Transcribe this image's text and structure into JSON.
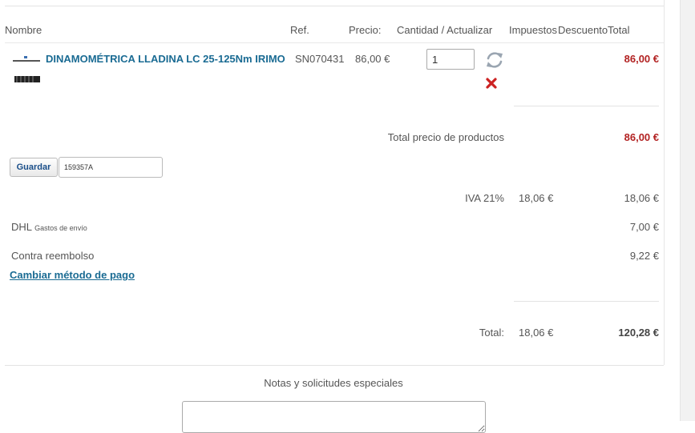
{
  "table_headers": {
    "name": "Nombre",
    "ref": "Ref.",
    "price": "Precio:",
    "quantity": "Cantidad / Actualizar",
    "taxes": "Impuestos",
    "discount": "Descuento",
    "total": "Total"
  },
  "product": {
    "name": "DINAMOMÉTRICA LLADINA LC 25-125Nm IRIMO",
    "ref": "SN070431",
    "price": "86,00 €",
    "quantity": "1",
    "total": "86,00 €",
    "thumbnail_icon": "torque-wrench-thumbnail",
    "refresh_icon": "refresh-icon",
    "delete_icon": "delete-icon"
  },
  "subtotal": {
    "label": "Total precio de productos",
    "value": "86,00 €"
  },
  "coupon": {
    "button_label": "Guardar",
    "value": "159357A"
  },
  "tax": {
    "label": "IVA 21%",
    "amount": "18,06 €",
    "total": "18,06 €"
  },
  "shipping": {
    "carrier": "DHL",
    "note": "Gastos de envío",
    "value": "7,00 €"
  },
  "payment": {
    "method": "Contra reembolso",
    "value": "9,22 €",
    "change_link": "Cambiar método de pago"
  },
  "grand_total": {
    "label": "Total:",
    "tax": "18,06 €",
    "value": "120,28 €"
  },
  "notes": {
    "title": "Notas y solicitudes especiales",
    "value": ""
  },
  "colors": {
    "link": "#1a6b93",
    "price_red": "#b22222",
    "delete_red": "#cc2222"
  }
}
